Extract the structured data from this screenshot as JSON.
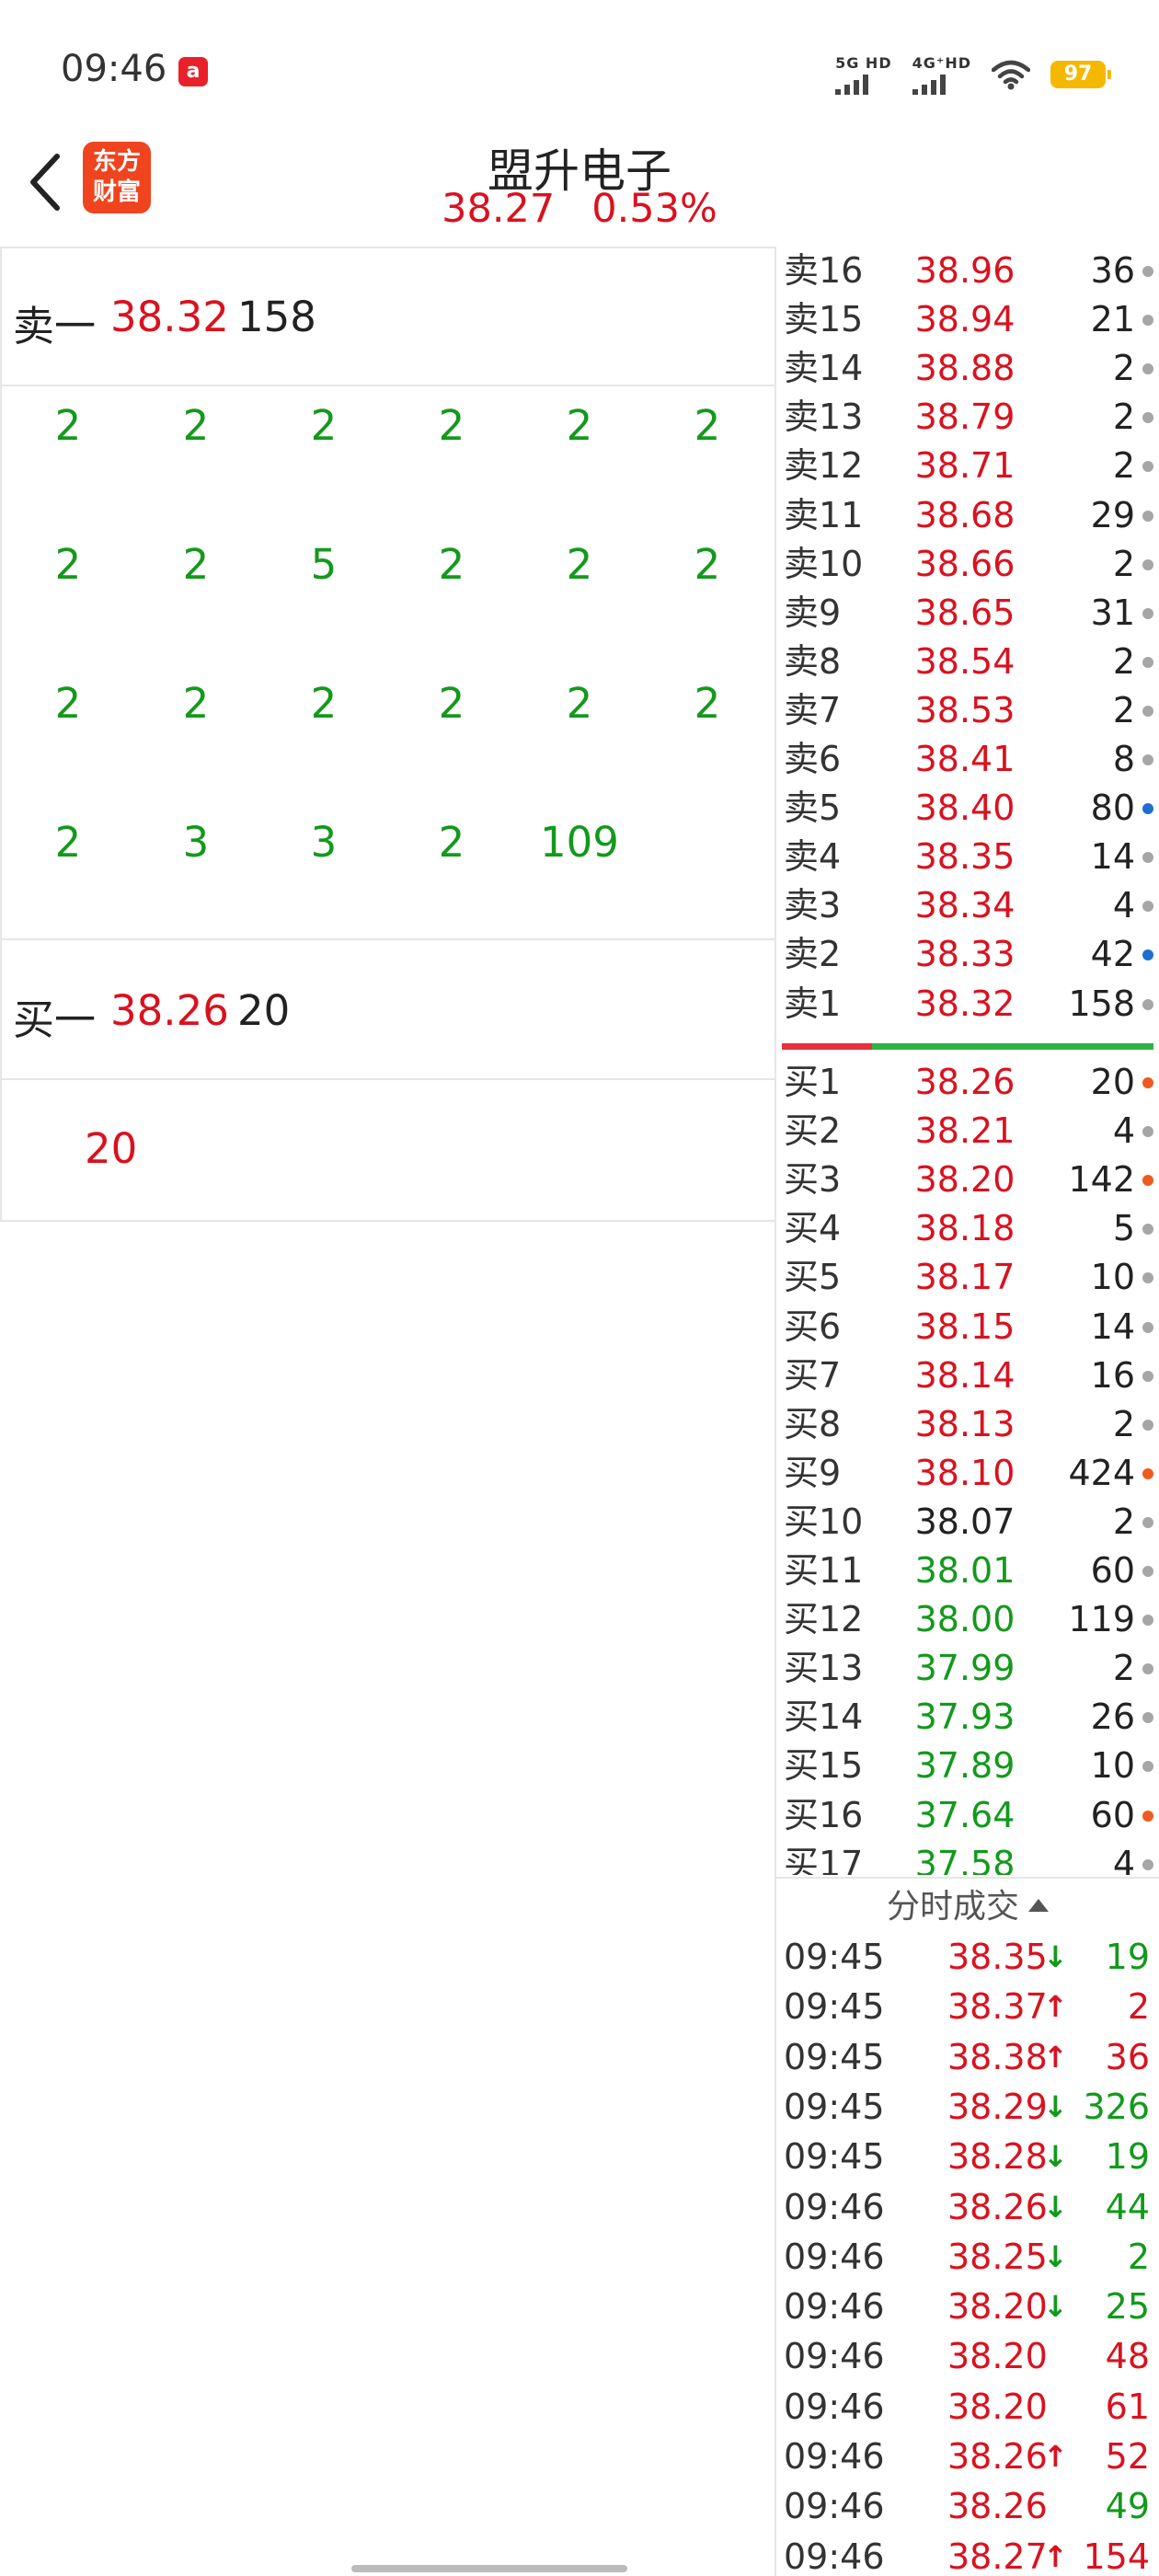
{
  "status_bar": {
    "time": "09:46",
    "app_badge": "a",
    "sig1": "5G HD",
    "sig2": "4G⁺HD",
    "battery": "97"
  },
  "header": {
    "logo_l1": "东方",
    "logo_l2": "财富",
    "title": "盟升电子",
    "price": "38.27",
    "change_pct": "0.53%"
  },
  "sell_best": {
    "label": "卖一",
    "price": "38.32",
    "volume": "158"
  },
  "sell_queue": [
    [
      "2",
      "2",
      "2",
      "2",
      "2",
      "2"
    ],
    [
      "2",
      "2",
      "5",
      "2",
      "2",
      "2"
    ],
    [
      "2",
      "2",
      "2",
      "2",
      "2",
      "2"
    ],
    [
      "2",
      "3",
      "3",
      "2",
      "109"
    ]
  ],
  "buy_best": {
    "label": "买一",
    "price": "38.26",
    "volume": "20"
  },
  "buy_queue": [
    "20"
  ],
  "colors": {
    "up": "#d9121f",
    "down": "#13991c",
    "flat": "#222222"
  },
  "order_book": {
    "asks": [
      {
        "label": "卖16",
        "price": "38.96",
        "vol": "36",
        "color": "red",
        "dot": "gray"
      },
      {
        "label": "卖15",
        "price": "38.94",
        "vol": "21",
        "color": "red",
        "dot": "gray"
      },
      {
        "label": "卖14",
        "price": "38.88",
        "vol": "2",
        "color": "red",
        "dot": "gray"
      },
      {
        "label": "卖13",
        "price": "38.79",
        "vol": "2",
        "color": "red",
        "dot": "gray"
      },
      {
        "label": "卖12",
        "price": "38.71",
        "vol": "2",
        "color": "red",
        "dot": "gray"
      },
      {
        "label": "卖11",
        "price": "38.68",
        "vol": "29",
        "color": "red",
        "dot": "gray"
      },
      {
        "label": "卖10",
        "price": "38.66",
        "vol": "2",
        "color": "red",
        "dot": "gray"
      },
      {
        "label": "卖9",
        "price": "38.65",
        "vol": "31",
        "color": "red",
        "dot": "gray"
      },
      {
        "label": "卖8",
        "price": "38.54",
        "vol": "2",
        "color": "red",
        "dot": "gray"
      },
      {
        "label": "卖7",
        "price": "38.53",
        "vol": "2",
        "color": "red",
        "dot": "gray"
      },
      {
        "label": "卖6",
        "price": "38.41",
        "vol": "8",
        "color": "red",
        "dot": "gray"
      },
      {
        "label": "卖5",
        "price": "38.40",
        "vol": "80",
        "color": "red",
        "dot": "blue"
      },
      {
        "label": "卖4",
        "price": "38.35",
        "vol": "14",
        "color": "red",
        "dot": "gray"
      },
      {
        "label": "卖3",
        "price": "38.34",
        "vol": "4",
        "color": "red",
        "dot": "gray"
      },
      {
        "label": "卖2",
        "price": "38.33",
        "vol": "42",
        "color": "red",
        "dot": "blue"
      },
      {
        "label": "卖1",
        "price": "38.32",
        "vol": "158",
        "color": "red",
        "dot": "gray"
      }
    ],
    "bids": [
      {
        "label": "买1",
        "price": "38.26",
        "vol": "20",
        "color": "red",
        "dot": "orange"
      },
      {
        "label": "买2",
        "price": "38.21",
        "vol": "4",
        "color": "red",
        "dot": "gray"
      },
      {
        "label": "买3",
        "price": "38.20",
        "vol": "142",
        "color": "red",
        "dot": "orange"
      },
      {
        "label": "买4",
        "price": "38.18",
        "vol": "5",
        "color": "red",
        "dot": "gray"
      },
      {
        "label": "买5",
        "price": "38.17",
        "vol": "10",
        "color": "red",
        "dot": "gray"
      },
      {
        "label": "买6",
        "price": "38.15",
        "vol": "14",
        "color": "red",
        "dot": "gray"
      },
      {
        "label": "买7",
        "price": "38.14",
        "vol": "16",
        "color": "red",
        "dot": "gray"
      },
      {
        "label": "买8",
        "price": "38.13",
        "vol": "2",
        "color": "red",
        "dot": "gray"
      },
      {
        "label": "买9",
        "price": "38.10",
        "vol": "424",
        "color": "red",
        "dot": "orange"
      },
      {
        "label": "买10",
        "price": "38.07",
        "vol": "2",
        "color": "black",
        "dot": "gray"
      },
      {
        "label": "买11",
        "price": "38.01",
        "vol": "60",
        "color": "green",
        "dot": "gray"
      },
      {
        "label": "买12",
        "price": "38.00",
        "vol": "119",
        "color": "green",
        "dot": "gray"
      },
      {
        "label": "买13",
        "price": "37.99",
        "vol": "2",
        "color": "green",
        "dot": "gray"
      },
      {
        "label": "买14",
        "price": "37.93",
        "vol": "26",
        "color": "green",
        "dot": "gray"
      },
      {
        "label": "买15",
        "price": "37.89",
        "vol": "10",
        "color": "green",
        "dot": "gray"
      },
      {
        "label": "买16",
        "price": "37.64",
        "vol": "60",
        "color": "green",
        "dot": "orange"
      },
      {
        "label": "买17",
        "price": "37.58",
        "vol": "4",
        "color": "green",
        "dot": "gray"
      }
    ]
  },
  "trades_header": "分时成交",
  "trades": [
    {
      "time": "09:45",
      "price": "38.35",
      "arrow": "↓",
      "vol": "19",
      "pc": "red",
      "vc": "green"
    },
    {
      "time": "09:45",
      "price": "38.37",
      "arrow": "↑",
      "vol": "2",
      "pc": "red",
      "vc": "red"
    },
    {
      "time": "09:45",
      "price": "38.38",
      "arrow": "↑",
      "vol": "36",
      "pc": "red",
      "vc": "red"
    },
    {
      "time": "09:45",
      "price": "38.29",
      "arrow": "↓",
      "vol": "326",
      "pc": "red",
      "vc": "green"
    },
    {
      "time": "09:45",
      "price": "38.28",
      "arrow": "↓",
      "vol": "19",
      "pc": "red",
      "vc": "green"
    },
    {
      "time": "09:46",
      "price": "38.26",
      "arrow": "↓",
      "vol": "44",
      "pc": "red",
      "vc": "green"
    },
    {
      "time": "09:46",
      "price": "38.25",
      "arrow": "↓",
      "vol": "2",
      "pc": "red",
      "vc": "green"
    },
    {
      "time": "09:46",
      "price": "38.20",
      "arrow": "↓",
      "vol": "25",
      "pc": "red",
      "vc": "green"
    },
    {
      "time": "09:46",
      "price": "38.20",
      "arrow": "",
      "vol": "48",
      "pc": "red",
      "vc": "red"
    },
    {
      "time": "09:46",
      "price": "38.20",
      "arrow": "",
      "vol": "61",
      "pc": "red",
      "vc": "red"
    },
    {
      "time": "09:46",
      "price": "38.26",
      "arrow": "↑",
      "vol": "52",
      "pc": "red",
      "vc": "red"
    },
    {
      "time": "09:46",
      "price": "38.26",
      "arrow": "",
      "vol": "49",
      "pc": "red",
      "vc": "green"
    },
    {
      "time": "09:46",
      "price": "38.27",
      "arrow": "↑",
      "vol": "154",
      "pc": "red",
      "vc": "red"
    }
  ]
}
